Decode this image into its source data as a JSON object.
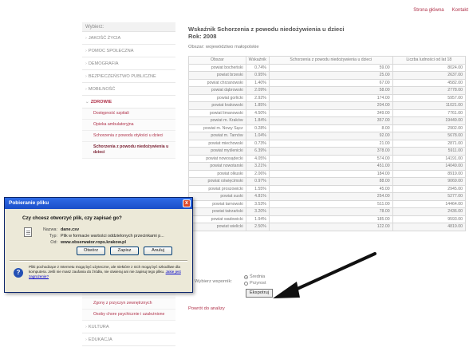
{
  "toplinks": [
    "Strona główna",
    "Kontakt"
  ],
  "sidebar": {
    "header": "Wybierz:",
    "items": [
      {
        "label": "JAKOŚĆ ŻYCIA"
      },
      {
        "label": "POMOC SPOŁECZNA"
      },
      {
        "label": "DEMOGRAFIA"
      },
      {
        "label": "BEZPIECZEŃSTWO PUBLICZNE"
      },
      {
        "label": "MOBILNOŚĆ"
      },
      {
        "label": "ZDROWIE"
      }
    ],
    "subitems": [
      {
        "label": "Dostępność szpitali"
      },
      {
        "label": "Opieka ambulatoryjna"
      },
      {
        "label": "Schorzenia z powodu otyłości u dzieci"
      },
      {
        "label": "Schorzenia z powodu niedożywienia u dzieci"
      }
    ],
    "bottom_subitems": [
      {
        "label": "Zaburzenia"
      },
      {
        "label": "Zgony z przyczyn zewnętrznych"
      },
      {
        "label": "Osoby chore psychicznie i uzależnione"
      }
    ],
    "bottom_items": [
      {
        "label": "KULTURA"
      },
      {
        "label": "EDUKACJA"
      }
    ]
  },
  "main": {
    "title": "Wskaźnik Schorzenia z powodu niedożywienia u dzieci",
    "year": "Rok: 2008",
    "region": "Obszar: województwo małopolskie",
    "table": {
      "headers": [
        "Obszar",
        "Wskaźnik",
        "Schorzenia z powodu niedożywienia u dzieci",
        "Liczba ludności od lat 18"
      ],
      "rows": [
        [
          "powiat bocheński",
          "0.74%",
          "59.00",
          "8024.00"
        ],
        [
          "powiat brzeski",
          "0.95%",
          "25.00",
          "2637.00"
        ],
        [
          "powiat chrzanowski",
          "1.40%",
          "67.00",
          "4582.00"
        ],
        [
          "powiat dąbrowski",
          "2.09%",
          "58.00",
          "2778.00"
        ],
        [
          "powiat gorlicki",
          "2.92%",
          "174.00",
          "5957.00"
        ],
        [
          "powiat krakowski",
          "1.85%",
          "204.00",
          "11021.00"
        ],
        [
          "powiat limanowski",
          "4.50%",
          "349.00",
          "7761.00"
        ],
        [
          "powiat m. Kraków",
          "1.84%",
          "357.00",
          "19449.00"
        ],
        [
          "powiat m. Nowy Sącz",
          "0.28%",
          "8.00",
          "2902.00"
        ],
        [
          "powiat m. Tarnów",
          "1.04%",
          "92.00",
          "5678.00"
        ],
        [
          "powiat miechowski",
          "0.73%",
          "21.00",
          "2871.00"
        ],
        [
          "powiat myślenicki",
          "6.39%",
          "378.00",
          "5911.00"
        ],
        [
          "powiat nowosądecki",
          "4.05%",
          "574.00",
          "14191.00"
        ],
        [
          "powiat nowotarski",
          "3.21%",
          "451.00",
          "14049.00"
        ],
        [
          "powiat olkuski",
          "2.06%",
          "184.00",
          "8919.00"
        ],
        [
          "powiat oświęcimski",
          "0.97%",
          "88.00",
          "9069.00"
        ],
        [
          "powiat proszowicki",
          "1.55%",
          "45.00",
          "2945.00"
        ],
        [
          "powiat suski",
          "4.81%",
          "254.00",
          "5277.00"
        ],
        [
          "powiat tarnowski",
          "3.53%",
          "511.00",
          "14464.00"
        ],
        [
          "powiat tatrzański",
          "3.20%",
          "78.00",
          "2436.00"
        ],
        [
          "powiat wadowicki",
          "1.94%",
          "185.00",
          "9593.00"
        ],
        [
          "powiat wielicki",
          "2.50%",
          "122.00",
          "4819.00"
        ]
      ]
    },
    "selector": {
      "label": "Wybierz wspornik:",
      "options": [
        "Średnia",
        "Przyrost"
      ],
      "button": "Ekspotruj"
    },
    "back_link": "Powrót do analizy"
  },
  "dialog": {
    "title": "Pobieranie pliku",
    "question": "Czy chcesz otworzyć plik, czy zapisać go?",
    "file": [
      {
        "key": "Nazwa:",
        "value": "dane.csv"
      },
      {
        "key": "Typ:",
        "value": "Plik w formacie wartości oddzielonych przecinkami p..."
      },
      {
        "key": "Od:",
        "value": "www.obserwator.rops.krakow.pl"
      }
    ],
    "buttons": [
      "Otwórz",
      "Zapisz",
      "Anuluj"
    ],
    "warning": "Pliki pochodzące z Internetu mogą być użyteczne, ale niektóre z nich mogą być szkodliwe dla komputera. Jeśli nie masz zaufania do źródła, nie otwieraj ani nie zapisuj tego pliku.",
    "warning_link": "Jakie jest zagrożenie?",
    "close_glyph": "x",
    "info_glyph": "?"
  }
}
